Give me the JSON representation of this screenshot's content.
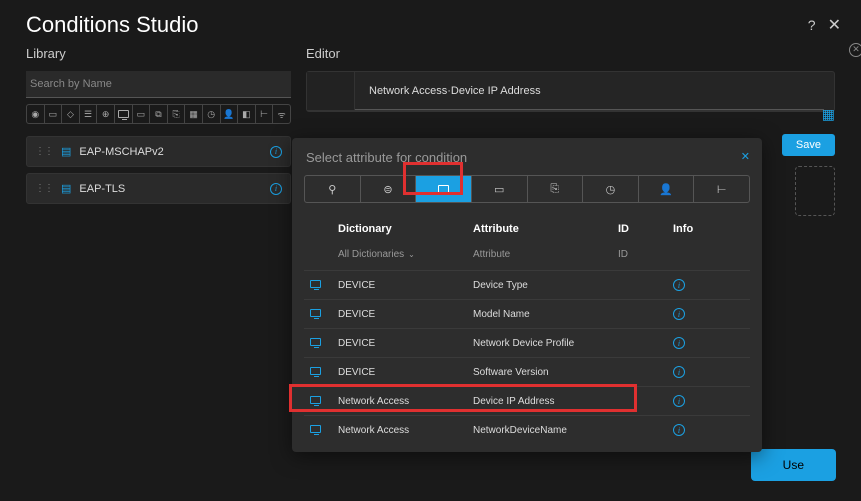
{
  "header": {
    "title": "Conditions Studio"
  },
  "library": {
    "label": "Library",
    "search_placeholder": "Search by Name",
    "items": [
      {
        "label": "EAP-MSCHAPv2"
      },
      {
        "label": "EAP-TLS"
      }
    ]
  },
  "editor": {
    "label": "Editor",
    "condition_text": "Network Access·Device IP Address",
    "save_label": "Save"
  },
  "footer": {
    "use_label": "Use"
  },
  "modal": {
    "title": "Select attribute for condition",
    "columns": {
      "dictionary": "Dictionary",
      "attribute": "Attribute",
      "id": "ID",
      "info": "Info"
    },
    "filters": {
      "dictionary": "All Dictionaries",
      "attribute": "Attribute",
      "id": "ID"
    },
    "rows": [
      {
        "dictionary": "DEVICE",
        "attribute": "Device Type"
      },
      {
        "dictionary": "DEVICE",
        "attribute": "Model Name"
      },
      {
        "dictionary": "DEVICE",
        "attribute": "Network Device Profile"
      },
      {
        "dictionary": "DEVICE",
        "attribute": "Software Version"
      },
      {
        "dictionary": "Network Access",
        "attribute": "Device IP Address"
      },
      {
        "dictionary": "Network Access",
        "attribute": "NetworkDeviceName"
      }
    ]
  }
}
